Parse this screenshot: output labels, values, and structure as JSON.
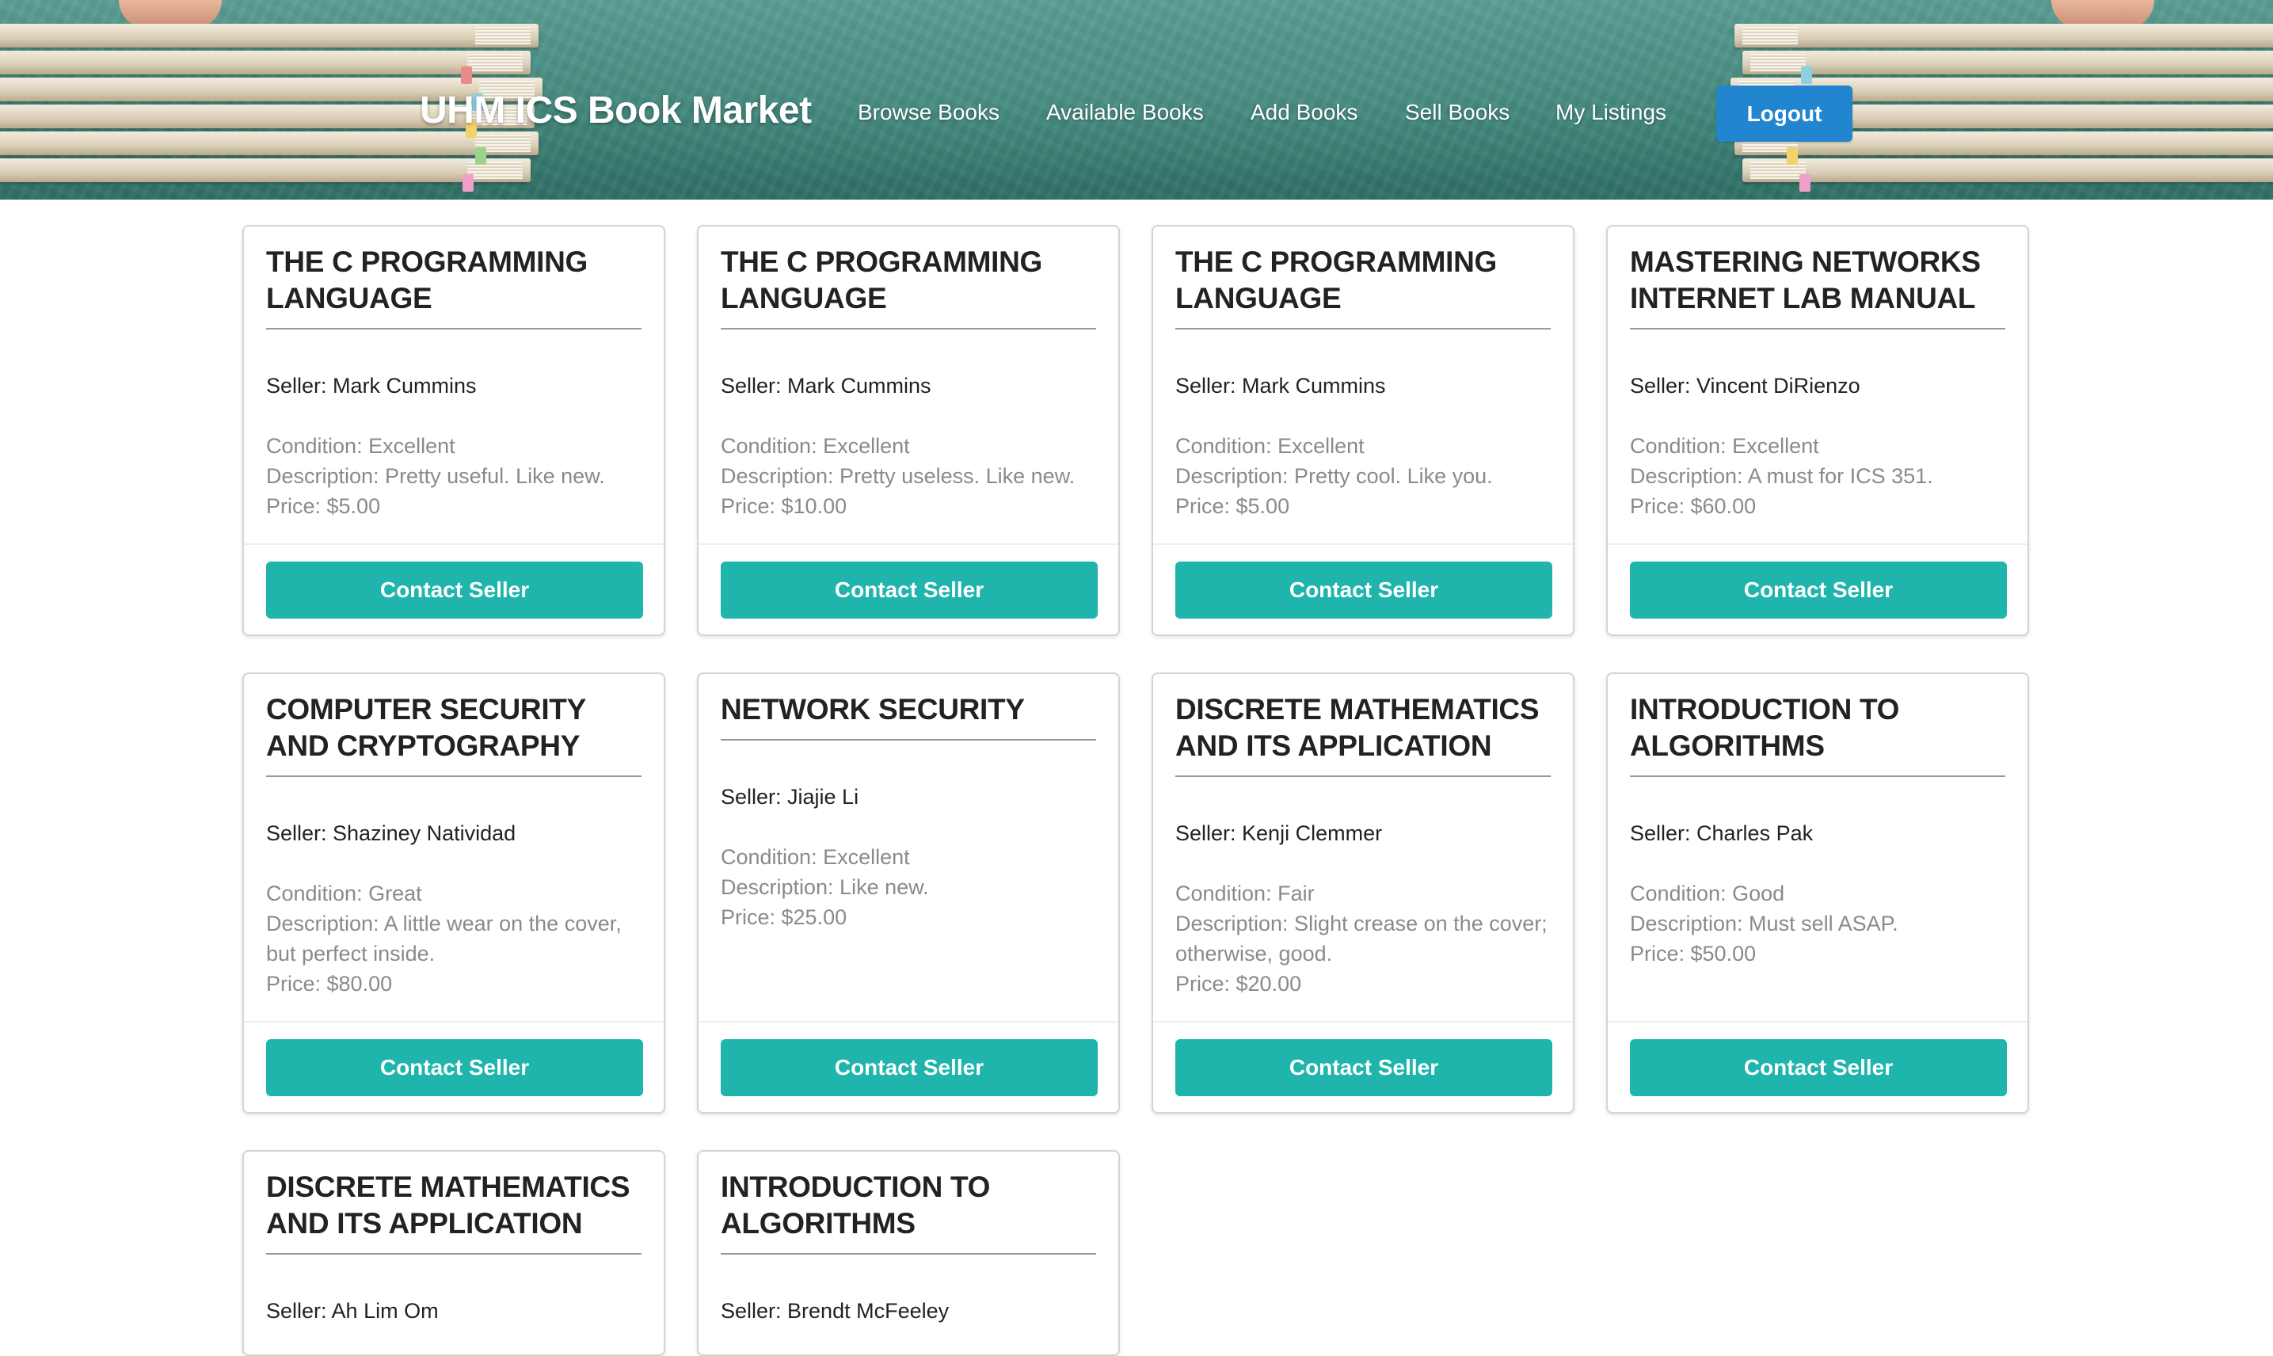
{
  "brand": "UHM ICS Book Market",
  "nav": {
    "browse": "Browse Books",
    "available": "Available Books",
    "add": "Add Books",
    "sell": "Sell Books",
    "listings": "My Listings",
    "logout": "Logout"
  },
  "colors": {
    "accent_teal": "#1fb5ac",
    "logout_blue": "#2185d0"
  },
  "cards": [
    {
      "title": "THE C PROGRAMMING LANGUAGE",
      "seller": "Seller: Mark Cummins",
      "condition": "Condition: Excellent",
      "description": "Description: Pretty useful. Like new.",
      "price": "Price: $5.00",
      "button": "Contact Seller"
    },
    {
      "title": "THE C PROGRAMMING LANGUAGE",
      "seller": "Seller: Mark Cummins",
      "condition": "Condition: Excellent",
      "description": "Description: Pretty useless. Like new.",
      "price": "Price: $10.00",
      "button": "Contact Seller"
    },
    {
      "title": "THE C PROGRAMMING LANGUAGE",
      "seller": "Seller: Mark Cummins",
      "condition": "Condition: Excellent",
      "description": "Description: Pretty cool. Like you.",
      "price": "Price: $5.00",
      "button": "Contact Seller"
    },
    {
      "title": "MASTERING NETWORKS INTERNET LAB MANUAL",
      "seller": "Seller: Vincent DiRienzo",
      "condition": "Condition: Excellent",
      "description": "Description: A must for ICS 351.",
      "price": "Price: $60.00",
      "button": "Contact Seller"
    },
    {
      "title": "COMPUTER SECURITY AND CRYPTOGRAPHY",
      "seller": "Seller: Shaziney Natividad",
      "condition": "Condition: Great",
      "description": "Description: A little wear on the cover, but perfect inside.",
      "price": "Price: $80.00",
      "button": "Contact Seller"
    },
    {
      "title": "NETWORK SECURITY",
      "seller": "Seller: Jiajie Li",
      "condition": "Condition: Excellent",
      "description": "Description: Like new.",
      "price": "Price: $25.00",
      "button": "Contact Seller"
    },
    {
      "title": "DISCRETE MATHEMATICS AND ITS APPLICATION",
      "seller": "Seller: Kenji Clemmer",
      "condition": "Condition: Fair",
      "description": "Description: Slight crease on the cover; otherwise, good.",
      "price": "Price: $20.00",
      "button": "Contact Seller"
    },
    {
      "title": "INTRODUCTION TO ALGORITHMS",
      "seller": "Seller: Charles Pak",
      "condition": "Condition: Good",
      "description": "Description: Must sell ASAP.",
      "price": "Price: $50.00",
      "button": "Contact Seller"
    },
    {
      "title": "DISCRETE MATHEMATICS AND ITS APPLICATION",
      "seller": "Seller: Ah Lim Om"
    },
    {
      "title": "INTRODUCTION TO ALGORITHMS",
      "seller": "Seller: Brendt McFeeley"
    }
  ]
}
